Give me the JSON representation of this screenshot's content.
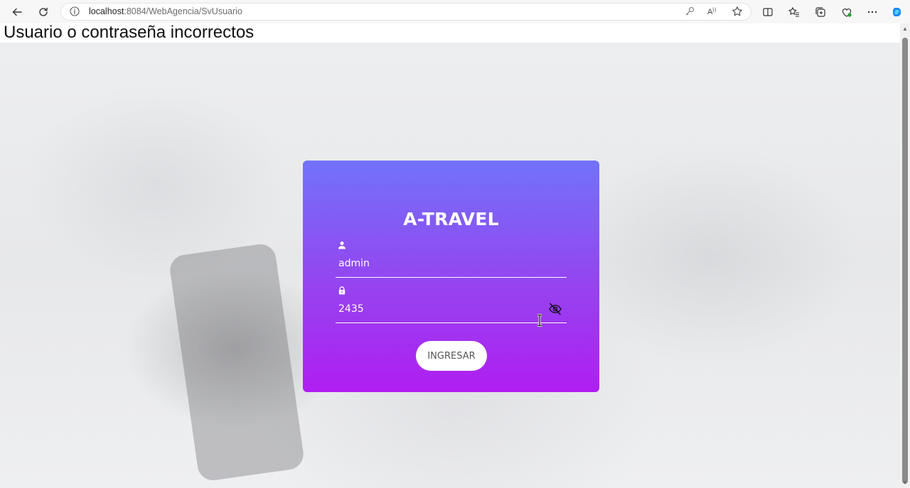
{
  "browser": {
    "url_host": "localhost",
    "url_rest": ":8084/WebAgencia/SvUsuario",
    "icons": [
      "back-icon",
      "refresh-icon",
      "info-icon",
      "key-icon",
      "read-aloud-icon",
      "favorite-star-icon",
      "split-screen-icon",
      "favorites-icon",
      "collections-icon",
      "extensions-icon",
      "more-icon",
      "copilot-icon"
    ]
  },
  "error_message": "Usuario o contraseña incorrectos",
  "login": {
    "title": "A-TRAVEL",
    "username_value": "admin",
    "password_value": "2435",
    "submit_label": "INGRESAR"
  },
  "colors": {
    "card_top": "#7272fa",
    "card_bottom": "#b01ef1",
    "button_bg": "#ffffff"
  }
}
